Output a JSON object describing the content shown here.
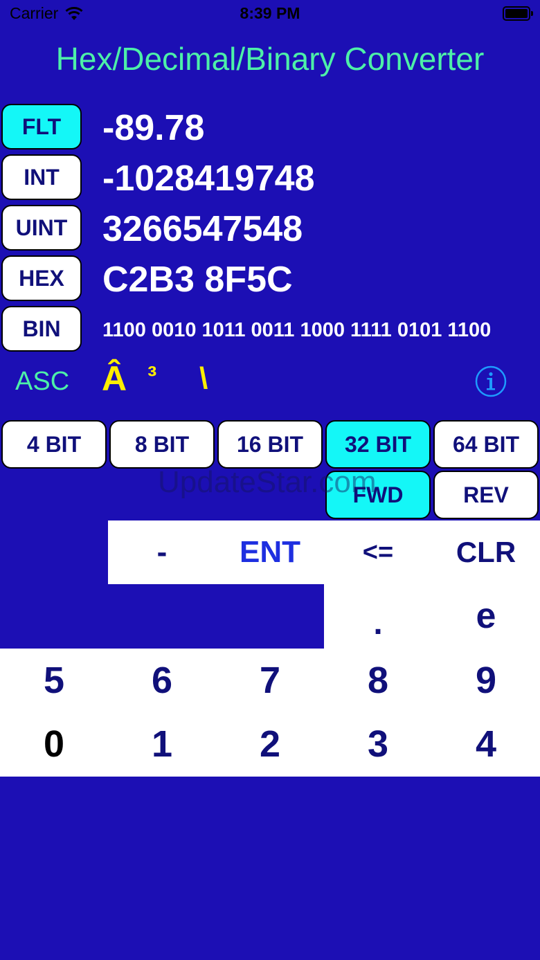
{
  "status_bar": {
    "carrier": "Carrier",
    "time": "8:39 PM"
  },
  "title": "Hex/Decimal/Binary Converter",
  "modes": [
    {
      "label": "FLT",
      "value": "-89.78",
      "active": true
    },
    {
      "label": "INT",
      "value": "-1028419748",
      "active": false
    },
    {
      "label": "UINT",
      "value": "3266547548",
      "active": false
    },
    {
      "label": "HEX",
      "value": "C2B3 8F5C",
      "active": false
    },
    {
      "label": "BIN",
      "value": "1100 0010 1011 0011 1000 1111 0101 1100",
      "active": false
    }
  ],
  "ascii": {
    "label": "ASC",
    "chars": [
      "Â",
      "³",
      "\\"
    ]
  },
  "bit_sizes": [
    {
      "label": "4 BIT",
      "active": false
    },
    {
      "label": "8 BIT",
      "active": false
    },
    {
      "label": "16 BIT",
      "active": false
    },
    {
      "label": "32 BIT",
      "active": true
    },
    {
      "label": "64 BIT",
      "active": false
    }
  ],
  "byte_order": {
    "fwd": "FWD",
    "rev": "REV",
    "active": "FWD"
  },
  "watermark": "UpdateStar.com",
  "keypad": {
    "minus": "-",
    "enter": "ENT",
    "backspace": "<=",
    "clear": "CLR",
    "dot": ".",
    "exp": "e",
    "row1": [
      "5",
      "6",
      "7",
      "8",
      "9"
    ],
    "row2": [
      "0",
      "1",
      "2",
      "3",
      "4"
    ]
  },
  "colors": {
    "background": "#1c0fb4",
    "accent": "#14f7f7",
    "title": "#4df0a8",
    "ascii_chars": "#ffee00",
    "key_text": "#10107a",
    "enter_text": "#1e2fe0"
  }
}
